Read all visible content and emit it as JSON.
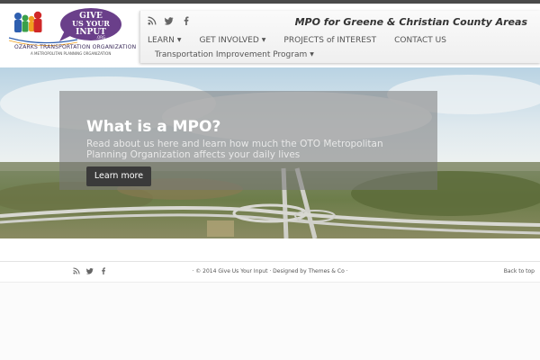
{
  "header": {
    "logo": {
      "line1": "GIVE",
      "line2": "US YOUR",
      "line3": "INPUT",
      "line4": ".ORG",
      "org_name": "OZARKS TRANSPORTATION ORGANIZATION",
      "org_sub": "A METROPOLITAN PLANNING ORGANIZATION",
      "bubble_color": "#6a3f8a"
    },
    "social_icons": [
      "rss-icon",
      "twitter-icon",
      "facebook-icon"
    ],
    "tagline": "MPO for Greene & Christian County Areas"
  },
  "nav": {
    "items": [
      {
        "label": "LEARN",
        "caret": "▼"
      },
      {
        "label": "GET INVOLVED",
        "caret": "▼"
      },
      {
        "label": "PROJECTS of INTEREST",
        "caret": ""
      },
      {
        "label": "CONTACT US",
        "caret": ""
      }
    ],
    "second_row": {
      "label": "Transportation Improvement Program",
      "caret": "▼"
    }
  },
  "hero": {
    "title": "What is a MPO?",
    "text": "Read about us here and learn how much the OTO Metropolitan Planning Organization affects your daily lives",
    "button": "Learn more"
  },
  "footer": {
    "social_icons": [
      "rss-icon",
      "twitter-icon",
      "facebook-icon"
    ],
    "copyright": "· © 2014 Give Us Your Input · Designed by Themes & Co ·",
    "back_to_top": "Back to top"
  },
  "colors": {
    "top_bar": "#4a4a4a",
    "button": "#3a3a3a",
    "overlay": "#787878",
    "logo_purple": "#6a3f8a"
  }
}
